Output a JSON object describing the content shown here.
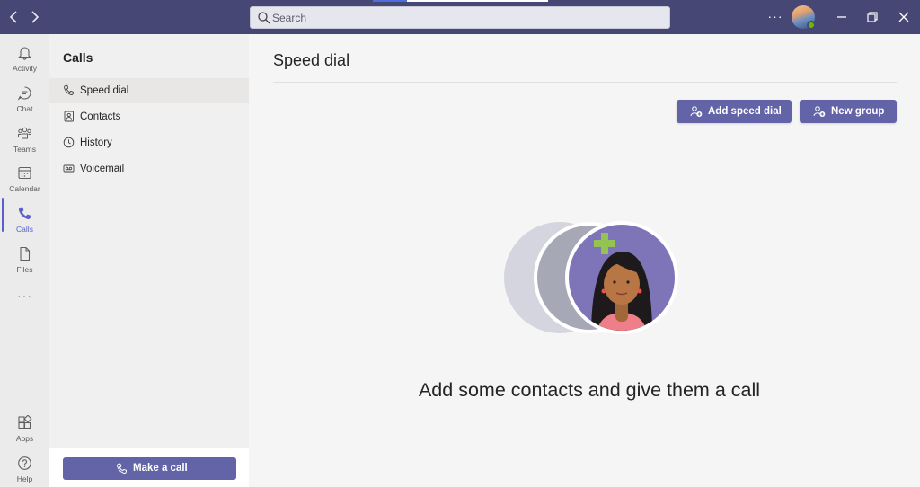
{
  "titlebar": {
    "back_icon": "chevron-left-icon",
    "forward_icon": "chevron-right-icon",
    "search_placeholder": "Search",
    "more_label": "···",
    "colors": {
      "bar": "#464775",
      "accent": "#6264a7"
    }
  },
  "rail": {
    "items": [
      {
        "label": "Activity",
        "icon": "bell-icon"
      },
      {
        "label": "Chat",
        "icon": "chat-icon"
      },
      {
        "label": "Teams",
        "icon": "teams-icon"
      },
      {
        "label": "Calendar",
        "icon": "calendar-icon"
      },
      {
        "label": "Calls",
        "icon": "phone-icon",
        "active": true
      },
      {
        "label": "Files",
        "icon": "file-icon"
      }
    ],
    "more_label": "···",
    "bottom": [
      {
        "label": "Apps",
        "icon": "apps-icon"
      },
      {
        "label": "Help",
        "icon": "help-icon"
      }
    ]
  },
  "panel": {
    "title": "Calls",
    "items": [
      {
        "label": "Speed dial",
        "icon": "phone-icon",
        "selected": true
      },
      {
        "label": "Contacts",
        "icon": "contacts-icon"
      },
      {
        "label": "History",
        "icon": "clock-icon"
      },
      {
        "label": "Voicemail",
        "icon": "voicemail-icon"
      }
    ],
    "make_call_label": "Make a call"
  },
  "main": {
    "title": "Speed dial",
    "add_speed_dial_label": "Add speed dial",
    "new_group_label": "New group",
    "empty_message": "Add some contacts and give them a call"
  }
}
